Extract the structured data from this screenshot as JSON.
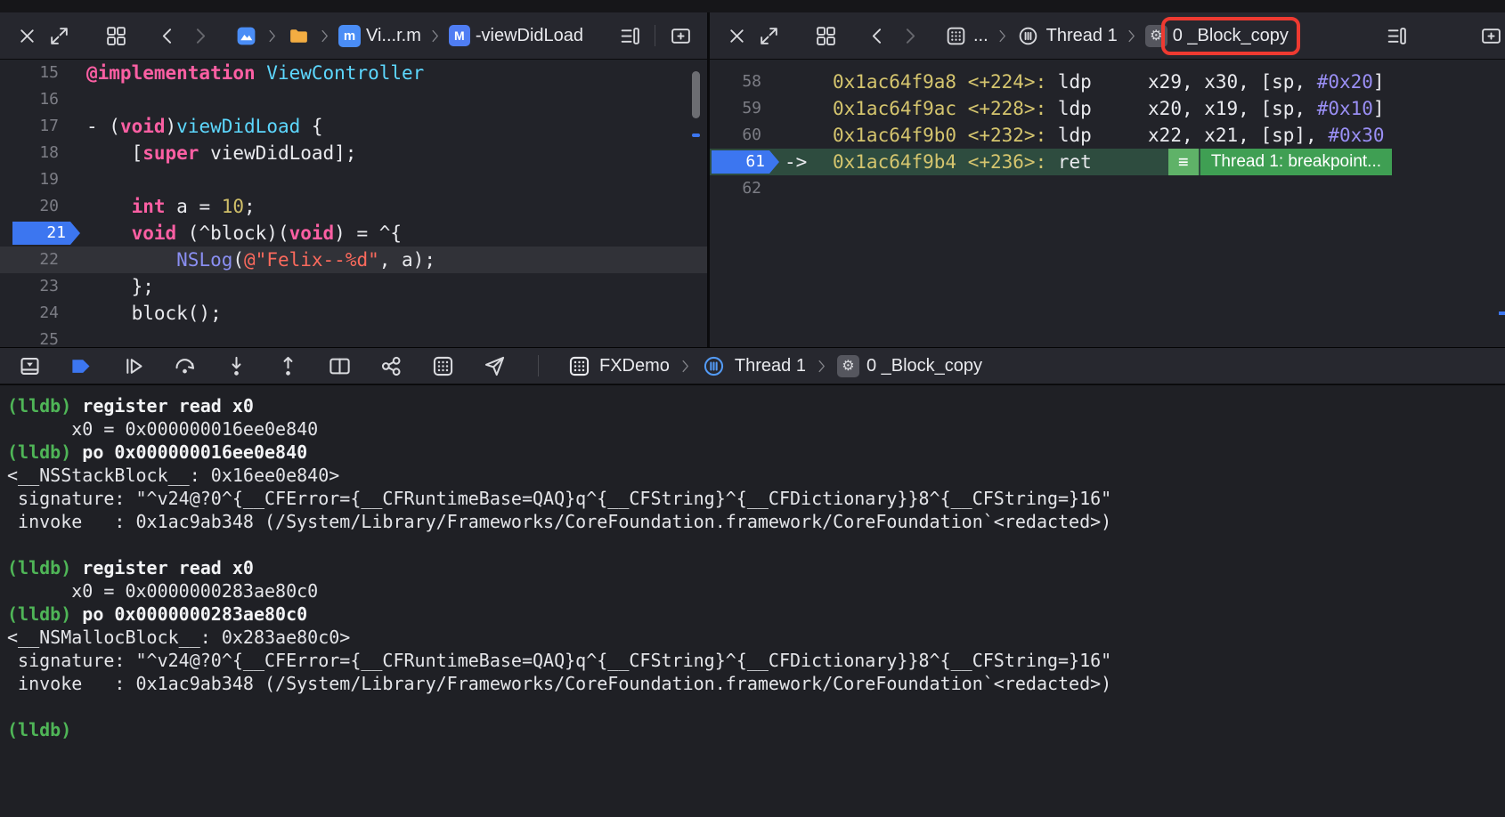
{
  "colors": {
    "accent-blue": "#3c76f0",
    "badge-green": "#3f9f53",
    "badge-green-light": "#5fb268",
    "row-green": "#2e4c3f",
    "annotation-red": "#ee3a31",
    "prompt-green": "#4fb557",
    "keyword-pink": "#fc5fa3",
    "type-cyan": "#5dd8ff",
    "number-yellow": "#d0bf69",
    "string-red": "#fc6a5d",
    "function-purple": "#8a8ff2",
    "address-yellow": "#d5c56e",
    "immediate-purple": "#9a8ff5"
  },
  "icons": {
    "gear": "⚙",
    "menu": "≡",
    "file_m": "m",
    "method_M": "M"
  },
  "left_editor": {
    "breadcrumb": {
      "file": "Vi...r.m",
      "symbol": "-viewDidLoad"
    },
    "lines": [
      {
        "num": "15",
        "segs": [
          [
            "@implementation ",
            "kw"
          ],
          [
            "ViewController",
            "type"
          ]
        ]
      },
      {
        "num": "16",
        "segs": []
      },
      {
        "num": "17",
        "segs": [
          [
            "- (",
            "pl"
          ],
          [
            "void",
            "kw"
          ],
          [
            ")",
            "pl"
          ],
          [
            "viewDidLoad",
            "type"
          ],
          [
            " {",
            "pl"
          ]
        ]
      },
      {
        "num": "18",
        "segs": [
          [
            "    [",
            "pl"
          ],
          [
            "super",
            "kw"
          ],
          [
            " viewDidLoad];",
            "pl"
          ]
        ]
      },
      {
        "num": "19",
        "segs": []
      },
      {
        "num": "20",
        "segs": [
          [
            "    ",
            "pl"
          ],
          [
            "int",
            "kw"
          ],
          [
            " a = ",
            "pl"
          ],
          [
            "10",
            "num"
          ],
          [
            ";",
            "pl"
          ]
        ]
      },
      {
        "num": "21",
        "breakpoint": true,
        "segs": [
          [
            "    ",
            "pl"
          ],
          [
            "void",
            "kw"
          ],
          [
            " (^block)(",
            "pl"
          ],
          [
            "void",
            "kw"
          ],
          [
            ") = ^{",
            "pl"
          ]
        ]
      },
      {
        "num": "22",
        "highlight": true,
        "segs": [
          [
            "        ",
            "pl"
          ],
          [
            "NSLog",
            "fn"
          ],
          [
            "(",
            "pl"
          ],
          [
            "@\"Felix--%d\"",
            "str"
          ],
          [
            ", a);",
            "pl"
          ]
        ]
      },
      {
        "num": "23",
        "segs": [
          [
            "    };",
            "pl"
          ]
        ]
      },
      {
        "num": "24",
        "segs": [
          [
            "    block();",
            "pl"
          ]
        ]
      },
      {
        "num": "25",
        "segs": []
      }
    ]
  },
  "right_editor": {
    "breadcrumb": {
      "project": "...",
      "thread": "Thread 1",
      "frame": "0 _Block_copy"
    },
    "arrow": "->",
    "breakpoint_badge": {
      "label": "Thread 1: breakpoint..."
    },
    "lines": [
      {
        "num": "58",
        "segs": [
          [
            "0x1ac64f9a8 <+224>: ",
            "addr"
          ],
          [
            "ldp     ",
            "pl"
          ],
          [
            "x29, x30, [sp, ",
            "pl"
          ],
          [
            "#0x20",
            "imm"
          ],
          [
            "]",
            "pl"
          ]
        ]
      },
      {
        "num": "59",
        "segs": [
          [
            "0x1ac64f9ac <+228>: ",
            "addr"
          ],
          [
            "ldp     ",
            "pl"
          ],
          [
            "x20, x19, [sp, ",
            "pl"
          ],
          [
            "#0x10",
            "imm"
          ],
          [
            "]",
            "pl"
          ]
        ]
      },
      {
        "num": "60",
        "segs": [
          [
            "0x1ac64f9b0 <+232>: ",
            "addr"
          ],
          [
            "ldp     ",
            "pl"
          ],
          [
            "x22, x21, [sp], ",
            "pl"
          ],
          [
            "#0x30",
            "imm"
          ]
        ]
      },
      {
        "num": "61",
        "current": true,
        "segs": [
          [
            "0x1ac64f9b4 <+236>: ",
            "addr"
          ],
          [
            "ret",
            "pl"
          ]
        ]
      },
      {
        "num": "62",
        "segs": []
      }
    ]
  },
  "debug_bar": {
    "project": "FXDemo",
    "thread": "Thread 1",
    "frame": "0 _Block_copy"
  },
  "console": {
    "lines": [
      {
        "segs": [
          [
            "(lldb) ",
            "prompt"
          ],
          [
            "register read x0",
            "cmd"
          ]
        ]
      },
      {
        "segs": [
          [
            "      x0 = 0x000000016ee0e840",
            "out"
          ]
        ]
      },
      {
        "segs": [
          [
            "(lldb) ",
            "prompt"
          ],
          [
            "po 0x000000016ee0e840",
            "cmd"
          ]
        ]
      },
      {
        "segs": [
          [
            "<__NSStackBlock__: 0x16ee0e840>",
            "out"
          ]
        ]
      },
      {
        "segs": [
          [
            " signature: \"^v24@?0^{__CFError={__CFRuntimeBase=QAQ}q^{__CFString}^{__CFDictionary}}8^{__CFString=}16\"",
            "out"
          ]
        ]
      },
      {
        "segs": [
          [
            " invoke   : 0x1ac9ab348 (/System/Library/Frameworks/CoreFoundation.framework/CoreFoundation`<redacted>)",
            "out"
          ]
        ]
      },
      {
        "segs": []
      },
      {
        "segs": [
          [
            "(lldb) ",
            "prompt"
          ],
          [
            "register read x0",
            "cmd"
          ]
        ]
      },
      {
        "segs": [
          [
            "      x0 = 0x0000000283ae80c0",
            "out"
          ]
        ]
      },
      {
        "segs": [
          [
            "(lldb) ",
            "prompt"
          ],
          [
            "po 0x0000000283ae80c0",
            "cmd"
          ]
        ]
      },
      {
        "segs": [
          [
            "<__NSMallocBlock__: 0x283ae80c0>",
            "out"
          ]
        ]
      },
      {
        "segs": [
          [
            " signature: \"^v24@?0^{__CFError={__CFRuntimeBase=QAQ}q^{__CFString}^{__CFDictionary}}8^{__CFString=}16\"",
            "out"
          ]
        ]
      },
      {
        "segs": [
          [
            " invoke   : 0x1ac9ab348 (/System/Library/Frameworks/CoreFoundation.framework/CoreFoundation`<redacted>)",
            "out"
          ]
        ]
      },
      {
        "segs": []
      },
      {
        "segs": [
          [
            "(lldb) ",
            "prompt"
          ]
        ]
      }
    ]
  }
}
